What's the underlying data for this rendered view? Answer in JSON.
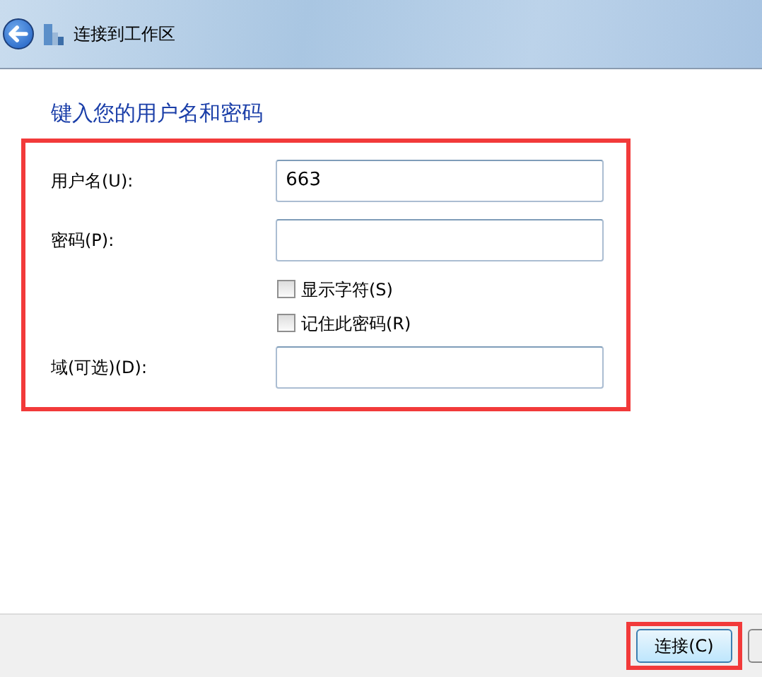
{
  "window": {
    "title": "连接到工作区"
  },
  "heading": "键入您的用户名和密码",
  "rows": [
    {
      "kind": "field",
      "label": "用户名(U):",
      "value": "663"
    },
    {
      "kind": "field",
      "label": "密码(P):",
      "value": ""
    },
    {
      "kind": "checkbox",
      "label": "显示字符(S)",
      "checked": false
    },
    {
      "kind": "checkbox",
      "label": "记住此密码(R)",
      "checked": false
    },
    {
      "kind": "field",
      "label": "域(可选)(D):",
      "value": ""
    }
  ],
  "buttons": [
    "连接(C)"
  ]
}
